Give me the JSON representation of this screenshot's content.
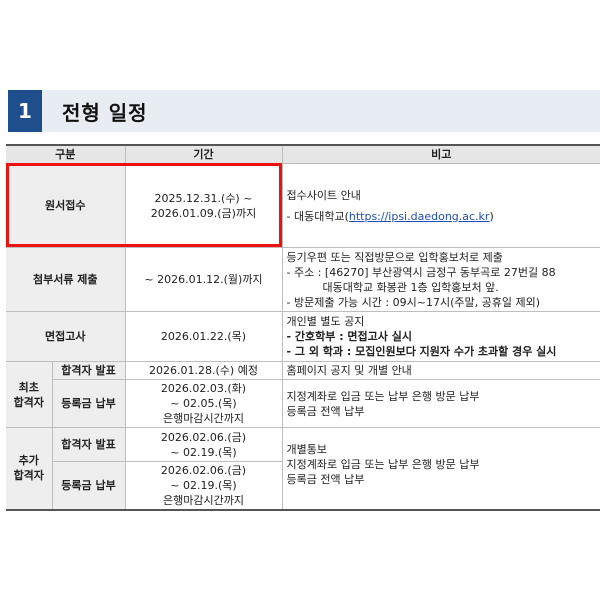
{
  "section": {
    "number": "1",
    "title": "전형 일정"
  },
  "table": {
    "headers": [
      "구분",
      "기간",
      "비고"
    ],
    "rows": {
      "application": {
        "label": "원서접수",
        "period": [
          "2025.12.31.(수) ~",
          "2026.01.09.(금)까지"
        ],
        "note_title": "접수사이트 안내",
        "note_prefix": "- 대동대학교(",
        "note_link": "https://ipsi.daedong.ac.kr",
        "note_suffix": ")"
      },
      "documents": {
        "label": "첨부서류 제출",
        "period": "~ 2026.01.12.(월)까지",
        "notes": [
          "등기우편 또는 직접방문으로 입학홍보처로 제출",
          "- 주소 : [46270] 부산광역시 금정구 동부곡로 27번길 88",
          "대동대학교 화봉관 1층 입학홍보처 앞.",
          "- 방문제출 가능 시간 : 09시~17시(주말, 공휴일 제외)"
        ]
      },
      "interview": {
        "label": "면접고사",
        "period": "2026.01.22.(목)",
        "notes": [
          "개인별 별도 공지",
          "- 간호학부 : 면접고사 실시",
          "- 그 외 학과 : 모집인원보다 지원자 수가 초과할 경우 실시"
        ]
      },
      "first": {
        "group_label": "최초\n합격자",
        "announce": {
          "label": "합격자 발표",
          "period": "2026.01.28.(수) 예정",
          "note": "홈페이지 공지 및 개별 안내"
        },
        "payment": {
          "label": "등록금 납부",
          "period": [
            "2026.02.03.(화)",
            "~ 02.05.(목)",
            "은행마감시간까지"
          ],
          "notes": [
            "지정계좌로 입금 또는 납부 은행 방문 납부",
            "등록금 전액 납부"
          ]
        }
      },
      "additional": {
        "group_label": "추가\n합격자",
        "announce": {
          "label": "합격자 발표",
          "period": [
            "2026.02.06.(금)",
            "~ 02.19.(목)"
          ]
        },
        "payment": {
          "label": "등록금 납부",
          "period": [
            "2026.02.06.(금)",
            "~ 02.19.(목)",
            "은행마감시간까지"
          ]
        },
        "notes": [
          "개별통보",
          "지정계좌로 입금 또는 납부 은행 방문 납부",
          "등록금 전액 납부"
        ]
      }
    }
  },
  "colors": {
    "section_number_bg": "#1f4e8c",
    "highlight_box": "#ee1111",
    "link": "#1f4eb8"
  }
}
